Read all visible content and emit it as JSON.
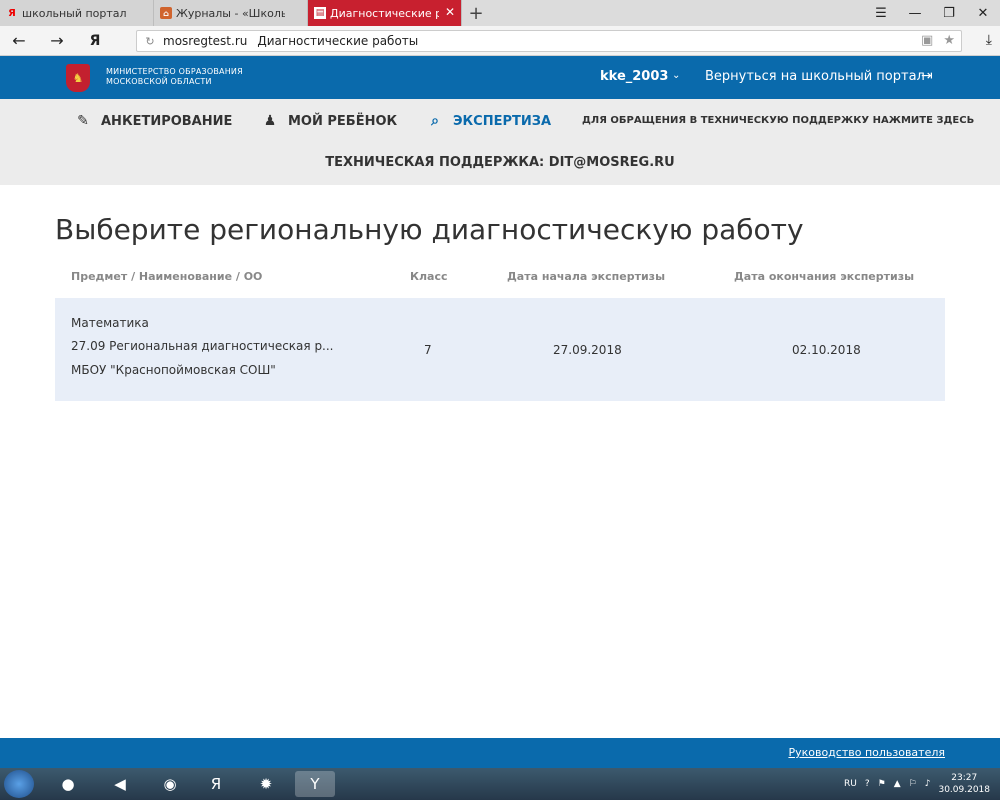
{
  "browser": {
    "tabs": [
      {
        "label": "школьный портал московс",
        "active": false,
        "icon": "yandex-icon"
      },
      {
        "label": "Журналы - «Школьный пор",
        "active": false,
        "icon": "school-icon"
      },
      {
        "label": "Диагностические работы",
        "active": true,
        "icon": "document-icon"
      }
    ],
    "url_domain": "mosregtest.ru",
    "url_title": "Диагностические работы"
  },
  "header": {
    "ministry_line1": "МИНИСТЕРСТВО ОБРАЗОВАНИЯ",
    "ministry_line2": "МОСКОВСКОЙ ОБЛАСТИ",
    "username": "kke_2003",
    "back_link": "Вернуться на школьный портал"
  },
  "nav": {
    "items": [
      {
        "label": "АНКЕТИРОВАНИЕ",
        "icon": "pencil-icon"
      },
      {
        "label": "МОЙ РЕБЁНОК",
        "icon": "child-icon"
      },
      {
        "label": "ЭКСПЕРТИЗА",
        "icon": "document-search-icon",
        "active": true
      }
    ],
    "support_link": "ДЛЯ ОБРАЩЕНИЯ В ТЕХНИЧЕСКУЮ ПОДДЕРЖКУ НАЖМИТЕ ЗДЕСЬ",
    "support_email": "ТЕХНИЧЕСКАЯ ПОДДЕРЖКА: DIT@MOSREG.RU"
  },
  "main": {
    "title": "Выберите региональную диагностическую работу",
    "columns": [
      "Предмет / Наименование / ОО",
      "Класс",
      "Дата начала экспертизы",
      "Дата окончания экспертизы"
    ],
    "rows": [
      {
        "subject": "Математика",
        "name": "27.09 Региональная диагностическая р...",
        "school": "МБОУ \"Краснопоймовская СОШ\"",
        "grade": "7",
        "start_date": "27.09.2018",
        "end_date": "02.10.2018"
      }
    ]
  },
  "footer": {
    "guide_link": "Руководство пользователя"
  },
  "taskbar": {
    "lang": "RU",
    "time": "23:27",
    "date": "30.09.2018"
  },
  "colors": {
    "brand_blue": "#0a6aac",
    "tab_active_red": "#c8202f",
    "row_bg": "#e8eef8"
  }
}
